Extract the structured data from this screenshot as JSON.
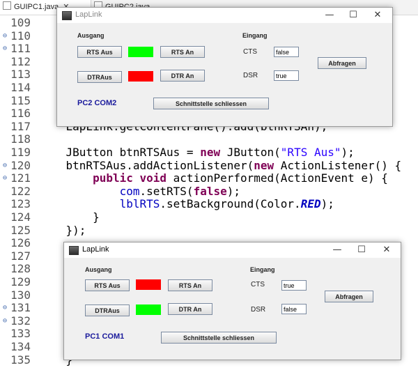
{
  "editor": {
    "tabs": [
      {
        "label": "GUIPC1.java",
        "close": "✕"
      },
      {
        "label": "GUIPC2.java"
      }
    ],
    "lines": [
      {
        "n": "109",
        "fold": "",
        "code": ""
      },
      {
        "n": "110",
        "fold": "⊖",
        "code": "                                    ) {"
      },
      {
        "n": "111",
        "fold": "⊖",
        "code": "                                    ) {"
      },
      {
        "n": "112",
        "fold": "",
        "code": ""
      },
      {
        "n": "113",
        "fold": "",
        "code": ""
      },
      {
        "n": "114",
        "fold": "",
        "code": ""
      },
      {
        "n": "115",
        "fold": "",
        "code": ""
      },
      {
        "n": "116",
        "fold": "",
        "code": ""
      },
      {
        "n": "117",
        "fold": "",
        "code": "    LapLink.getContentPane().add(btnRTSAn);"
      },
      {
        "n": "118",
        "fold": "",
        "code": ""
      },
      {
        "n": "119",
        "fold": "",
        "code": "    JButton btnRTSAus = new JButton(\"RTS Aus\");"
      },
      {
        "n": "120",
        "fold": "⊖",
        "code": "    btnRTSAus.addActionListener(new ActionListener() {"
      },
      {
        "n": "121",
        "fold": "⊖",
        "code": "        public void actionPerformed(ActionEvent e) {"
      },
      {
        "n": "122",
        "fold": "",
        "code": "            com.setRTS(false);"
      },
      {
        "n": "123",
        "fold": "",
        "code": "            lblRTS.setBackground(Color.RED);"
      },
      {
        "n": "124",
        "fold": "",
        "code": "        }"
      },
      {
        "n": "125",
        "fold": "",
        "code": "    });"
      },
      {
        "n": "126",
        "fold": "",
        "code": ""
      },
      {
        "n": "127",
        "fold": "",
        "code": ""
      },
      {
        "n": "128",
        "fold": "",
        "code": ""
      },
      {
        "n": "129",
        "fold": "",
        "code": ""
      },
      {
        "n": "130",
        "fold": "",
        "code": ""
      },
      {
        "n": "131",
        "fold": "⊖",
        "code": "                                        {"
      },
      {
        "n": "132",
        "fold": "⊖",
        "code": "                                        {"
      },
      {
        "n": "133",
        "fold": "",
        "code": ""
      },
      {
        "n": "134",
        "fold": "",
        "code": ""
      },
      {
        "n": "135",
        "fold": "",
        "code": "    }"
      }
    ]
  },
  "window1": {
    "title": "LapLink",
    "minimize": "—",
    "maximize": "☐",
    "close": "✕",
    "ausgang": "Ausgang",
    "eingang": "Eingang",
    "rts_aus": "RTS Aus",
    "rts_an": "RTS An",
    "dtr_aus": "DTRAus",
    "dtr_an": "DTR An",
    "cts_label": "CTS",
    "dsr_label": "DSR",
    "cts_value": "false",
    "dsr_value": "true",
    "abfragen": "Abfragen",
    "port": "PC2 COM2",
    "close_port": "Schnittstelle schliessen",
    "rts_led_color": "#00ff00",
    "dtr_led_color": "#ff0000"
  },
  "window2": {
    "title": "LapLink",
    "minimize": "—",
    "maximize": "☐",
    "close": "✕",
    "ausgang": "Ausgang",
    "eingang": "Eingang",
    "rts_aus": "RTS Aus",
    "rts_an": "RTS An",
    "dtr_aus": "DTRAus",
    "dtr_an": "DTR An",
    "cts_label": "CTS",
    "dsr_label": "DSR",
    "cts_value": "true",
    "dsr_value": "false",
    "abfragen": "Abfragen",
    "port": "PC1 COM1",
    "close_port": "Schnittstelle schliessen",
    "rts_led_color": "#ff0000",
    "dtr_led_color": "#00ff00"
  }
}
